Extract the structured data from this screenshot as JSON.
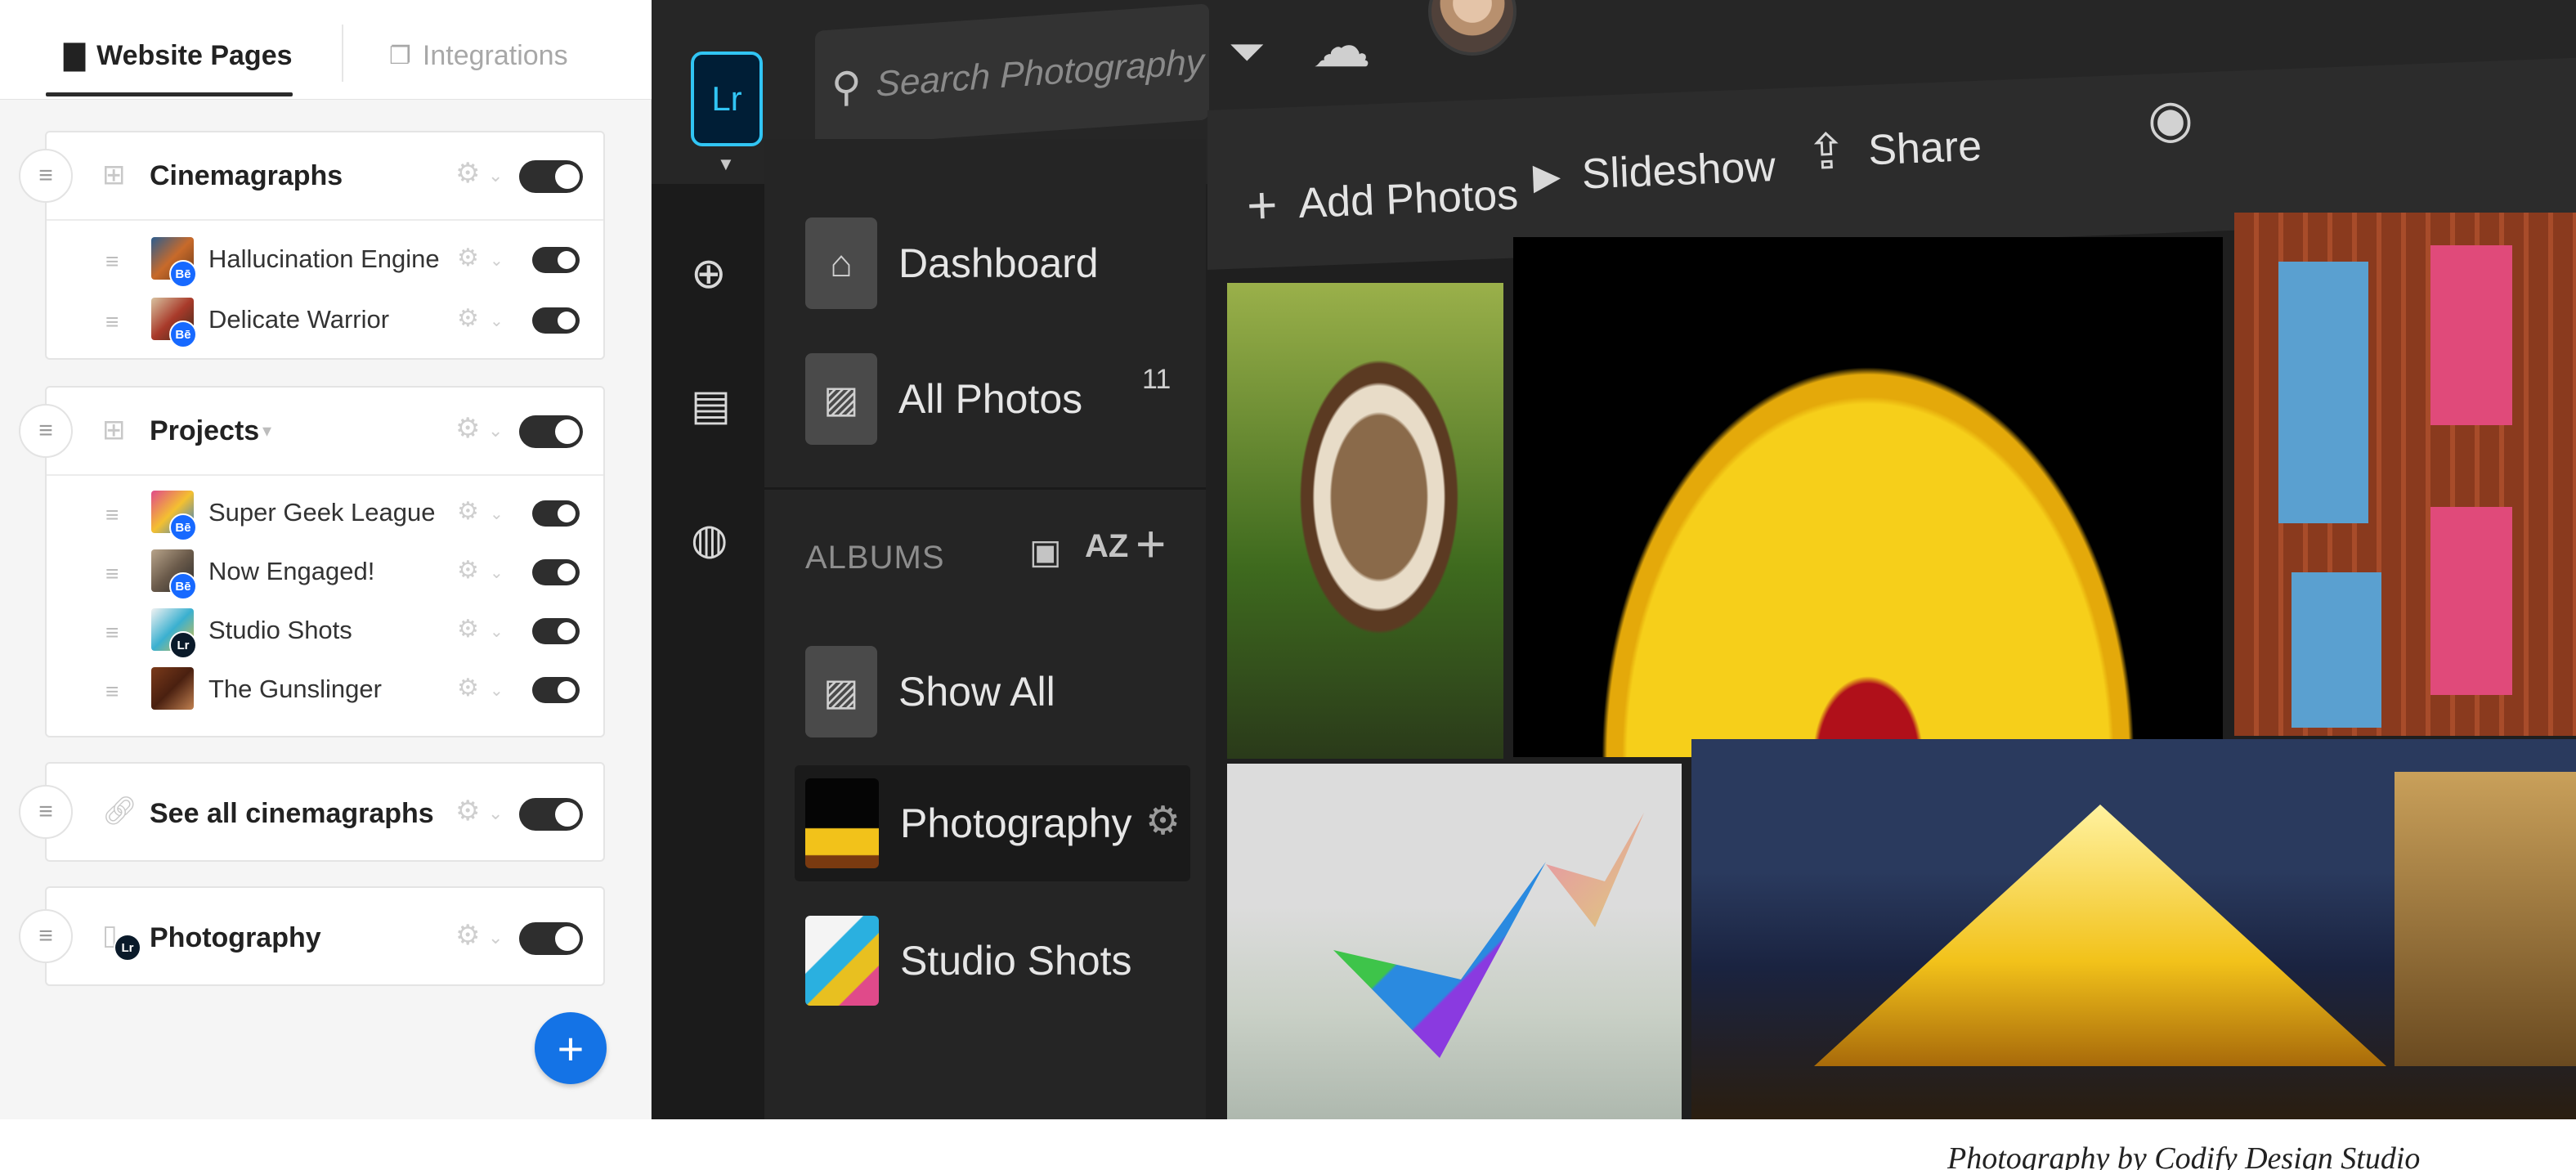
{
  "left_panel": {
    "tabs": [
      {
        "label": "Website Pages",
        "active": true
      },
      {
        "label": "Integrations",
        "active": false
      }
    ],
    "groups": [
      {
        "label": "Cinemagraphs",
        "enabled": true,
        "items": [
          {
            "label": "Hallucination Engine",
            "badge": "Bē",
            "enabled": true
          },
          {
            "label": "Delicate Warrior",
            "badge": "Bē",
            "enabled": true
          }
        ]
      },
      {
        "label": "Projects",
        "enabled": true,
        "items": [
          {
            "label": "Super Geek League",
            "badge": "Bē",
            "enabled": true
          },
          {
            "label": "Now Engaged!",
            "badge": "Bē",
            "enabled": true
          },
          {
            "label": "Studio Shots",
            "badge": "Lr",
            "enabled": true
          },
          {
            "label": "The Gunslinger",
            "badge": "",
            "enabled": true
          }
        ]
      },
      {
        "label": "See all cinemagraphs",
        "enabled": true
      },
      {
        "label": "Photography",
        "badge": "Lr",
        "enabled": true
      }
    ],
    "fab_label": "+"
  },
  "lightroom": {
    "logo": "Lr",
    "search_placeholder": "Search Photography",
    "toolbar": {
      "add_photos": "Add Photos",
      "slideshow": "Slideshow",
      "share": "Share"
    },
    "nav": {
      "dashboard": "Dashboard",
      "all_photos": "All Photos",
      "all_photos_count": "11"
    },
    "albums": {
      "heading": "ALBUMS",
      "sort_label": "AZ",
      "items": [
        {
          "label": "Show All"
        },
        {
          "label": "Photography",
          "selected": true
        },
        {
          "label": "Studio Shots"
        }
      ]
    },
    "icons": {
      "filter": "filter-icon",
      "cloud": "cloud-icon",
      "eye": "eye-icon"
    }
  },
  "caption": "Photography by Codify Design Studio",
  "colors": {
    "accent_blue": "#1473e6",
    "behance_blue": "#1769ff",
    "lr_cyan": "#31c5f4",
    "toggle_dark": "#2e2e2e"
  }
}
